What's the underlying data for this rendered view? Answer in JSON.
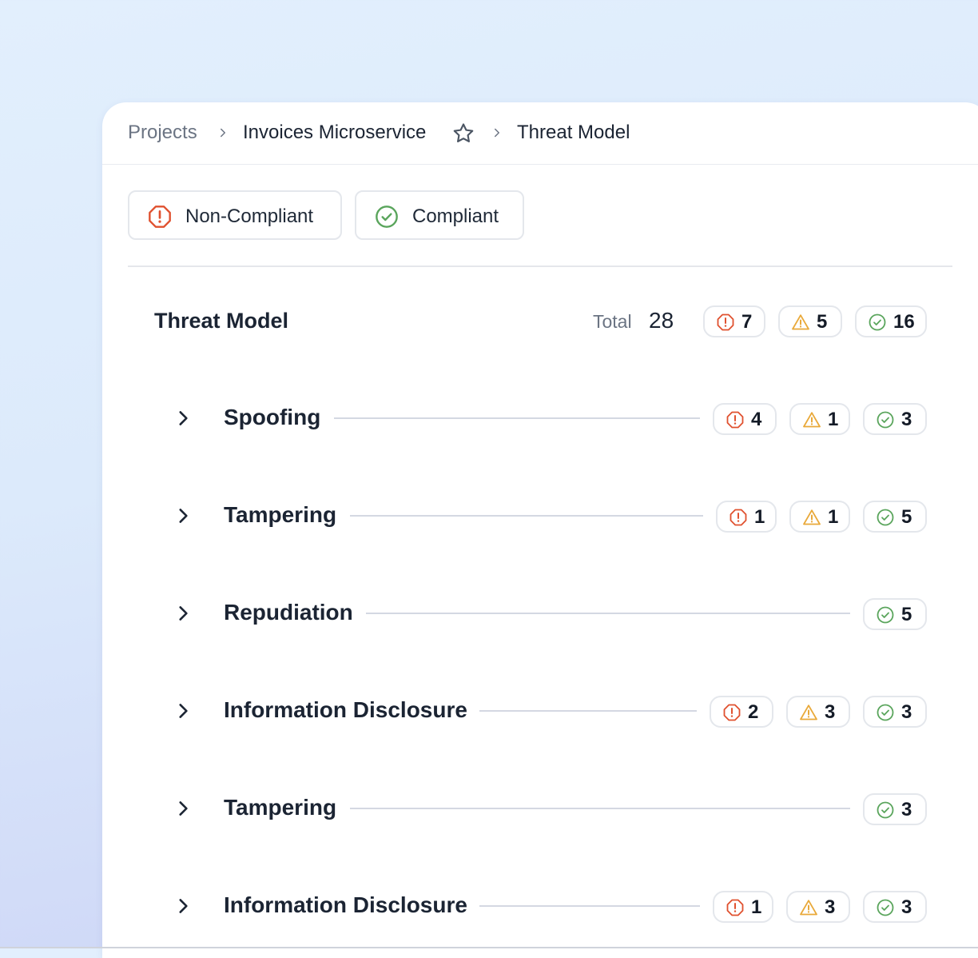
{
  "breadcrumb": {
    "items": [
      "Projects",
      "Invoices Microservice",
      "Threat Model"
    ]
  },
  "filters": [
    {
      "label": "Non-Compliant",
      "icon": "octagon-alert-icon"
    },
    {
      "label": "Compliant",
      "icon": "circle-check-icon"
    }
  ],
  "threat_model": {
    "title": "Threat Model",
    "total_label": "Total",
    "total": "28",
    "counts": {
      "critical": "7",
      "warning": "5",
      "compliant": "16"
    }
  },
  "categories": [
    {
      "label": "Spoofing",
      "critical": "4",
      "warning": "1",
      "compliant": "3"
    },
    {
      "label": "Tampering",
      "critical": "1",
      "warning": "1",
      "compliant": "5"
    },
    {
      "label": "Repudiation",
      "compliant": "5"
    },
    {
      "label": "Information Disclosure",
      "critical": "2",
      "warning": "3",
      "compliant": "3"
    },
    {
      "label": "Tampering",
      "compliant": "3"
    },
    {
      "label": "Information Disclosure",
      "critical": "1",
      "warning": "3",
      "compliant": "3"
    }
  ],
  "colors": {
    "critical": "#e0512f",
    "warning": "#e9a93a",
    "compliant": "#5aa55c"
  }
}
